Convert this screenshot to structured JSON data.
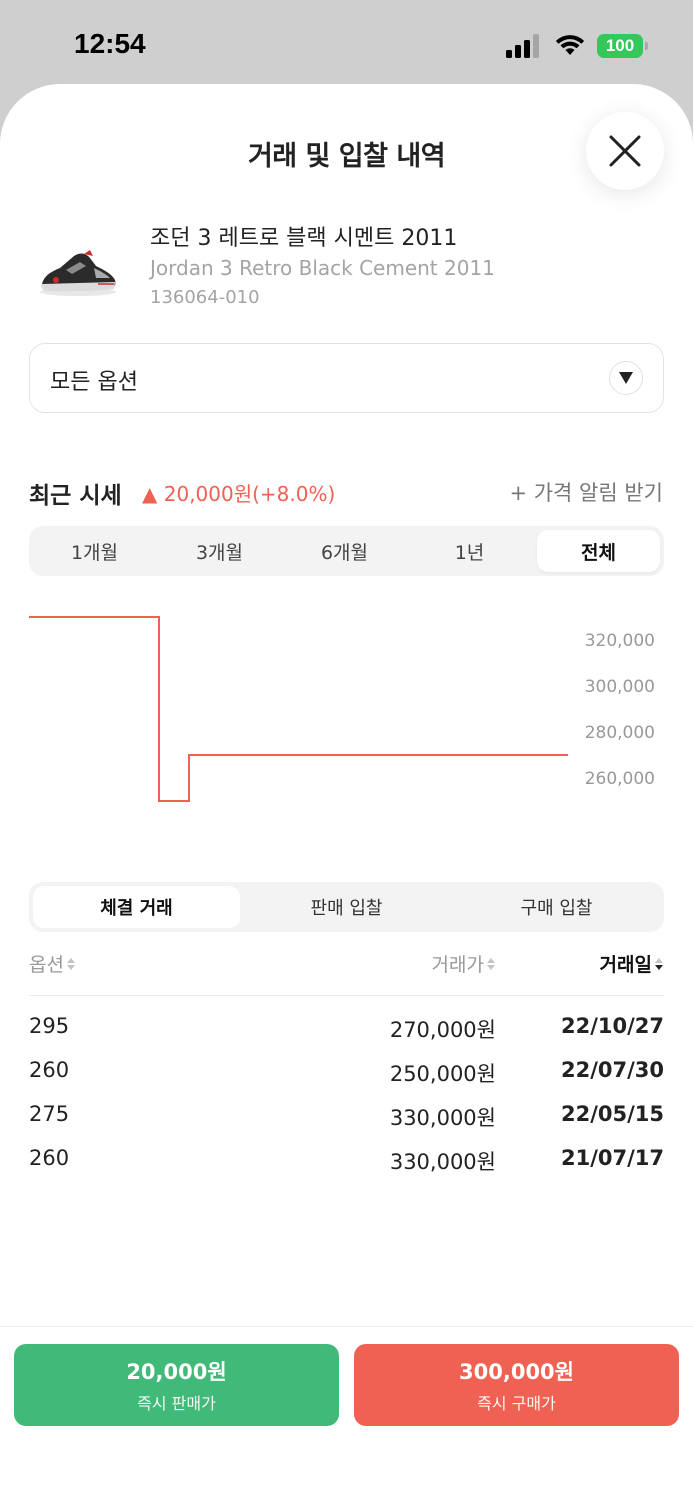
{
  "status_bar": {
    "time": "12:54",
    "battery": "100"
  },
  "sheet": {
    "title": "거래 및 입찰 내역",
    "close_icon": "close-icon"
  },
  "product": {
    "name_ko": "조던 3 레트로 블랙 시멘트 2011",
    "name_en": "Jordan 3 Retro Black Cement 2011",
    "model_code": "136064-010",
    "image_icon": "sneaker-image"
  },
  "options": {
    "selected": "모든 옵션"
  },
  "recent_price": {
    "title": "최근 시세",
    "change": "▲ 20,000원(+8.0%)",
    "alert_label": "+ 가격 알림 받기",
    "accent_color": "#ef6253"
  },
  "period_tabs": [
    {
      "label": "1개월",
      "active": false
    },
    {
      "label": "3개월",
      "active": false
    },
    {
      "label": "6개월",
      "active": false
    },
    {
      "label": "1년",
      "active": false
    },
    {
      "label": "전체",
      "active": true
    }
  ],
  "chart_data": {
    "type": "line",
    "style": "step",
    "series": [
      {
        "values": [
          330000,
          330000,
          250000,
          270000,
          270000
        ]
      }
    ],
    "y_ticks": [
      "320,000",
      "300,000",
      "280,000",
      "260,000"
    ],
    "ylim": [
      240000,
      340000
    ],
    "grid": false,
    "line_color": "#ef6253"
  },
  "trade_tabs": [
    {
      "label": "체결 거래",
      "active": true
    },
    {
      "label": "판매 입찰",
      "active": false
    },
    {
      "label": "구매 입찰",
      "active": false
    }
  ],
  "table": {
    "headers": {
      "option": "옵션",
      "price": "거래가",
      "date": "거래일"
    },
    "rows": [
      {
        "option": "295",
        "price": "270,000원",
        "date": "22/10/27"
      },
      {
        "option": "260",
        "price": "250,000원",
        "date": "22/07/30"
      },
      {
        "option": "275",
        "price": "330,000원",
        "date": "22/05/15"
      },
      {
        "option": "260",
        "price": "330,000원",
        "date": "21/07/17"
      }
    ]
  },
  "actions": {
    "sell": {
      "price": "20,000원",
      "label": "즉시 판매가",
      "color": "#41b979"
    },
    "buy": {
      "price": "300,000원",
      "label": "즉시 구매가",
      "color": "#ef6253"
    }
  }
}
